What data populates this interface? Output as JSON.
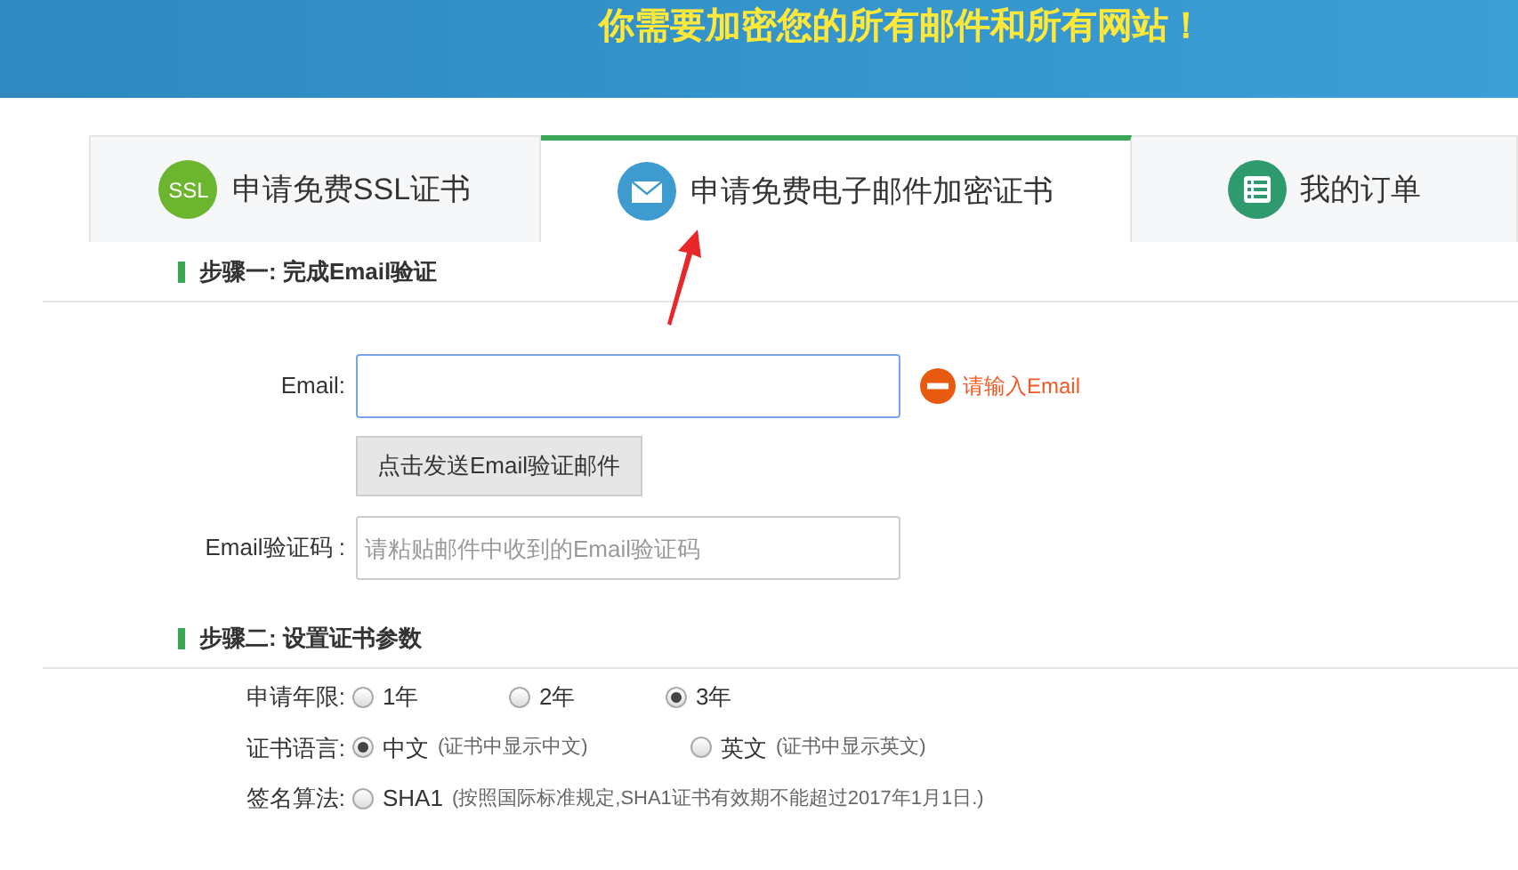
{
  "banner": {
    "headline": "你需要加密您的所有邮件和所有网站！"
  },
  "tabs": [
    {
      "label": "申请免费SSL证书",
      "kind": "ssl",
      "icon_text": "SSL",
      "selected": false
    },
    {
      "label": "申请免费电子邮件加密证书",
      "kind": "mail",
      "selected": true
    },
    {
      "label": "我的订单",
      "kind": "list",
      "selected": false
    }
  ],
  "step1": {
    "title": "步骤一: 完成Email验证",
    "email_label": "Email:",
    "email_error": "请输入Email",
    "send_button": "点击发送Email验证邮件",
    "code_label": "Email验证码 :",
    "code_placeholder": "请粘贴邮件中收到的Email验证码"
  },
  "step2": {
    "title": "步骤二: 设置证书参数",
    "rows": [
      {
        "label": "申请年限:",
        "options": [
          {
            "text": "1年",
            "selected": false
          },
          {
            "text": "2年",
            "selected": false
          },
          {
            "text": "3年",
            "selected": true
          }
        ]
      },
      {
        "label": "证书语言:",
        "options": [
          {
            "text": "中文",
            "note": "(证书中显示中文)",
            "selected": true
          },
          {
            "text": "英文",
            "note": "(证书中显示英文)",
            "selected": false
          }
        ]
      },
      {
        "label": "签名算法:",
        "options": [
          {
            "text": "SHA1",
            "note": "(按照国际标准规定,SHA1证书有效期不能超过2017年1月1日.)",
            "selected": false
          }
        ]
      }
    ]
  }
}
